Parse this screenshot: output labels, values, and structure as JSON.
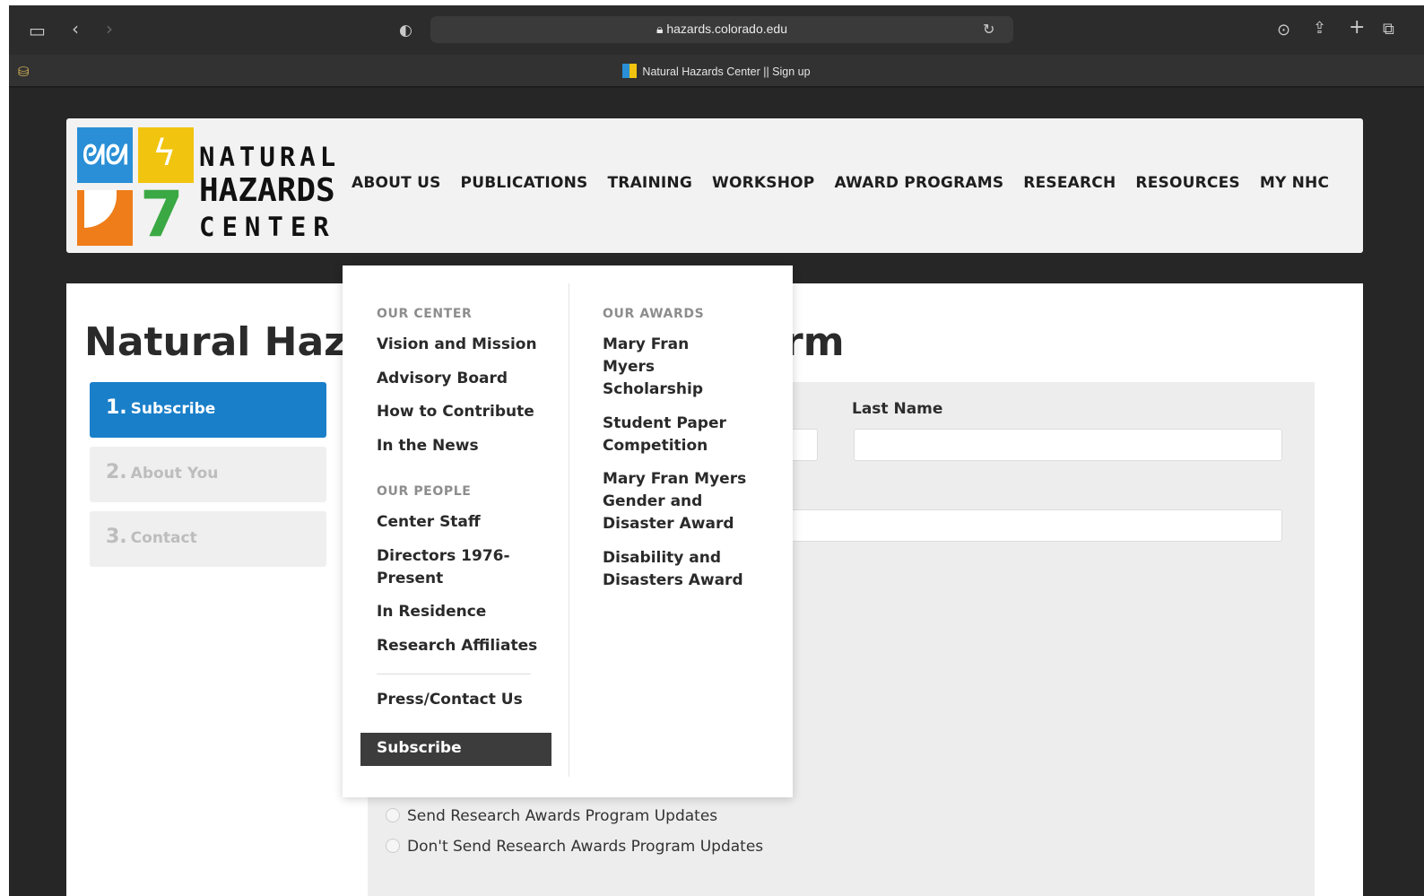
{
  "browser": {
    "url": "hazards.colorado.edu",
    "tab_title": "Natural Hazards Center || Sign up"
  },
  "logo": {
    "line1": "NATURAL",
    "line2": "HAZARDS",
    "line3": "CENTER"
  },
  "nav": [
    "ABOUT US",
    "PUBLICATIONS",
    "TRAINING",
    "WORKSHOP",
    "AWARD PROGRAMS",
    "RESEARCH",
    "RESOURCES",
    "MY NHC"
  ],
  "page": {
    "title": "Natural Haza",
    "title_tail": "rm"
  },
  "steps": [
    {
      "num": "1.",
      "label": "Subscribe"
    },
    {
      "num": "2.",
      "label": "About You"
    },
    {
      "num": "3.",
      "label": "Contact"
    }
  ],
  "form": {
    "last_name_label": "Last Name",
    "radio_1": "Send Research Awards Program Updates",
    "radio_2": "Don't Send Research Awards Program Updates"
  },
  "dropdown": {
    "our_center_heading": "OUR CENTER",
    "our_center": [
      "Vision and Mission",
      "Advisory Board",
      "How to Contribute",
      "In the News"
    ],
    "our_people_heading": "OUR PEOPLE",
    "our_people": [
      "Center Staff",
      "Directors 1976-Present",
      "In Residence",
      "Research Affiliates"
    ],
    "press_contact": "Press/Contact Us",
    "subscribe": "Subscribe",
    "our_awards_heading": "OUR AWARDS",
    "our_awards": [
      "Mary Fran Myers Scholarship",
      "Student Paper Competition",
      "Mary Fran Myers Gender and Disaster Award",
      "Disability and Disasters Award"
    ]
  },
  "colors": {
    "active_step": "#1a7fc9",
    "logo_blue": "#2a8fd6",
    "logo_yellow": "#f1c40f",
    "logo_orange": "#ef7d1a",
    "logo_green": "#3aa843"
  }
}
